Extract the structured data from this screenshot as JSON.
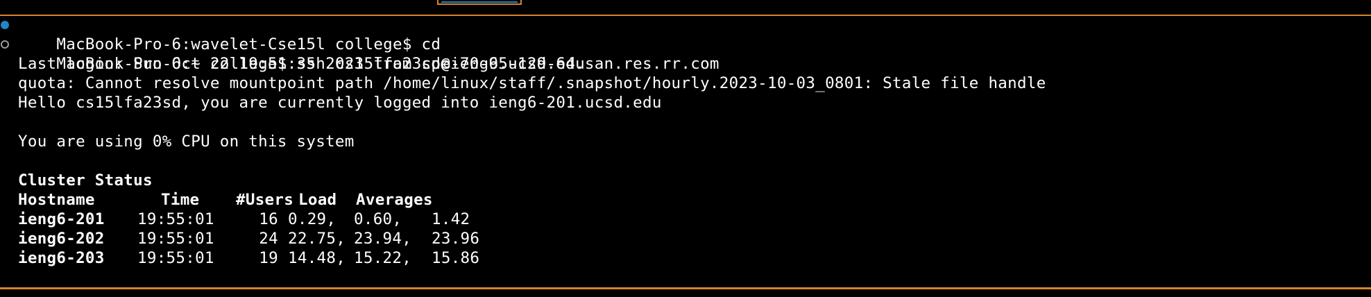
{
  "colors": {
    "background": "#000000",
    "text": "#ffffff",
    "accent_border": "#d9822b",
    "active_mark": "#1e88c8",
    "inactive_mark": "#9a9a9a"
  },
  "terminal": {
    "lines": {
      "cmd1": "MacBook-Pro-6:wavelet-Cse15l college$ cd",
      "cmd2": "MacBook-Pro-6:~ college$ ssh cs15lfa23sd@ieng6.ucsd.edu",
      "last_login": "Last login: Sun Oct 22 19:51:35 2023 from cpe-70-95-129-64.san.res.rr.com",
      "quota": "quota: Cannot resolve mountpoint path /home/linux/staff/.snapshot/hourly.2023-10-03_0801: Stale file handle",
      "hello": "Hello cs15lfa23sd, you are currently logged into ieng6-201.ucsd.edu",
      "cpu": "You are using 0% CPU on this system",
      "cluster_title": "Cluster Status"
    },
    "cluster_table": {
      "headers": [
        "Hostname",
        "Time",
        "#Users",
        "Load",
        "Averages"
      ],
      "rows": [
        {
          "host": "ieng6-201",
          "time": "19:55:01",
          "users": "16",
          "load1": "0.29,",
          "load5": "0.60,",
          "load15": "1.42"
        },
        {
          "host": "ieng6-202",
          "time": "19:55:01",
          "users": "24",
          "load1": "22.75,",
          "load5": "23.94,",
          "load15": "23.96"
        },
        {
          "host": "ieng6-203",
          "time": "19:55:01",
          "users": "19",
          "load1": "14.48,",
          "load5": "15.22,",
          "load15": "15.86"
        }
      ]
    }
  }
}
